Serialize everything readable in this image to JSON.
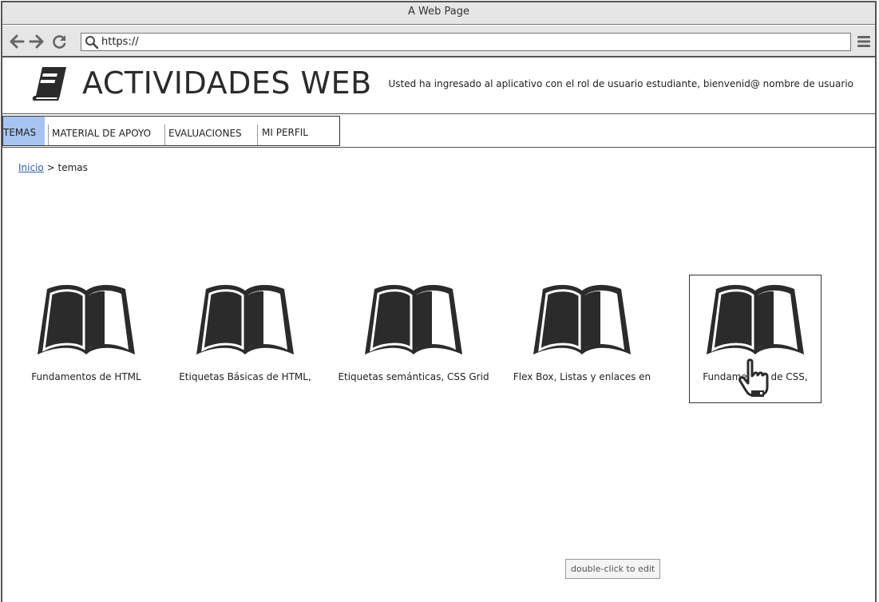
{
  "window": {
    "title": "A Web Page"
  },
  "browser": {
    "url": "https://",
    "back_icon": "arrow-left-icon",
    "forward_icon": "arrow-right-icon",
    "reload_icon": "reload-icon",
    "menu_icon": "hamburger-menu-icon"
  },
  "header": {
    "logo_icon": "book-icon",
    "site_title": "ACTIVIDADES WEB",
    "welcome": "Usted ha ingresado al aplicativo con el rol de usuario estudiante, bienvenid@ nombre de usuario"
  },
  "menu": {
    "items": [
      {
        "label": "TEMAS",
        "active": true
      },
      {
        "label": "MATERIAL DE APOYO",
        "active": false
      },
      {
        "label": "EVALUACIONES",
        "active": false
      },
      {
        "label": "MI PERFIL",
        "active": false
      }
    ],
    "active_color": "#a6c4ef"
  },
  "breadcrumb": {
    "home": "Inicio",
    "separator": ">",
    "current": "temas"
  },
  "topics": [
    {
      "label": "Fundamentos de HTML",
      "icon": "open-book-icon"
    },
    {
      "label": "Etiquetas Básicas de HTML,",
      "icon": "open-book-icon"
    },
    {
      "label": "Etiquetas semánticas, CSS Grid",
      "icon": "open-book-icon"
    },
    {
      "label": "Flex Box, Listas y enlaces en",
      "icon": "open-book-icon"
    },
    {
      "label": "Fundamentos de CSS,",
      "icon": "open-book-icon",
      "selected": true
    }
  ],
  "hint": {
    "label": "double-click to edit"
  }
}
